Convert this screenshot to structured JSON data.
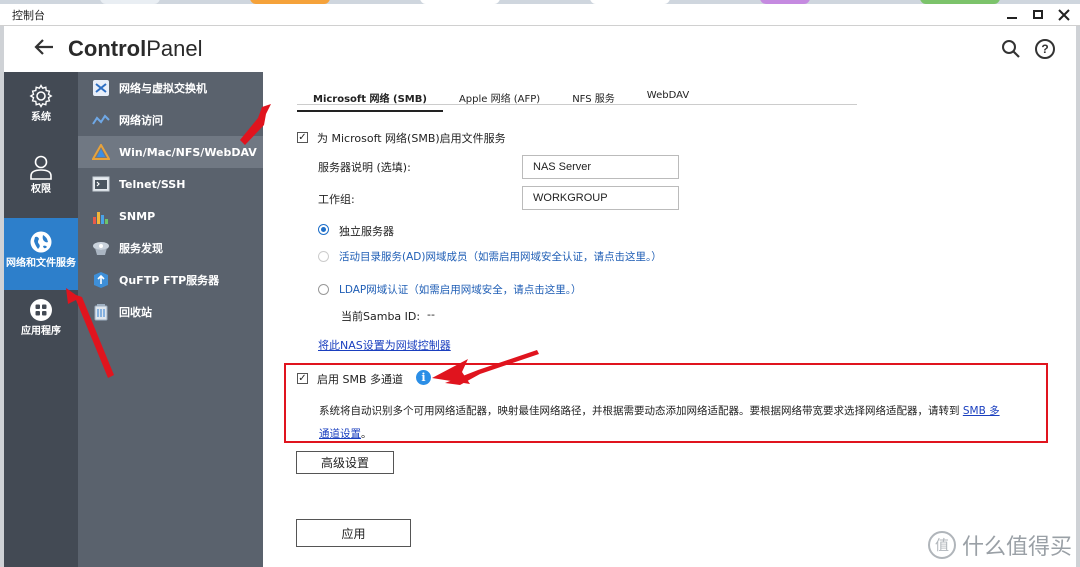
{
  "window": {
    "title": "控制台"
  },
  "header": {
    "app_title_bold": "Control",
    "app_title_rest": "Panel"
  },
  "nav1": [
    {
      "label": "系统",
      "icon": "gear-icon"
    },
    {
      "label": "权限",
      "icon": "user-icon"
    },
    {
      "label": "网络和文件服务",
      "icon": "globe-icon",
      "active": true
    },
    {
      "label": "应用程序",
      "icon": "apps-grid-icon"
    }
  ],
  "nav2": [
    {
      "label": "网络与虚拟交换机",
      "icon": "network-switch-icon"
    },
    {
      "label": "网络访问",
      "icon": "network-access-icon"
    },
    {
      "label": "Win/Mac/NFS/WebDAV",
      "icon": "file-service-icon",
      "active": true
    },
    {
      "label": "Telnet/SSH",
      "icon": "terminal-icon"
    },
    {
      "label": "SNMP",
      "icon": "bar-chart-icon"
    },
    {
      "label": "服务发现",
      "icon": "service-discovery-icon"
    },
    {
      "label": "QuFTP FTP服务器",
      "icon": "ftp-icon"
    },
    {
      "label": "回收站",
      "icon": "recycle-bin-icon"
    }
  ],
  "tabs": [
    "Microsoft 网络 (SMB)",
    "Apple 网络 (AFP)",
    "NFS 服务",
    "WebDAV"
  ],
  "smb": {
    "enable_label": "为 Microsoft 网络(SMB)启用文件服务",
    "enable_checked": true,
    "server_desc_label": "服务器说明 (选填):",
    "server_desc_value": "NAS Server",
    "workgroup_label": "工作组:",
    "workgroup_value": "WORKGROUP",
    "radio_standalone": "独立服务器",
    "radio_ad": "活动目录服务(AD)网域成员（如需启用网域安全认证，请点击这里。）",
    "radio_ldap": "LDAP网域认证（如需启用网域安全，请点击这里。）",
    "samba_id_label": "当前Samba ID:",
    "samba_id_value": "--",
    "domain_controller_link": "将此NAS设置为网域控制器",
    "multichannel_label": "启用 SMB 多通道",
    "multichannel_checked": true,
    "multichannel_desc": "系统将自动识别多个可用网络适配器，映射最佳网络路径，并根据需要动态添加网络适配器。要根据网络带宽要求选择网络适配器，请转到",
    "multichannel_link_a": "SMB 多",
    "multichannel_link_b": "通道设置",
    "multichannel_desc_end": "。",
    "advanced_button": "高级设置",
    "apply_button": "应用"
  },
  "watermark": {
    "text": "什么值得买",
    "logo": "值"
  },
  "colors": {
    "nav1_bg": "#434a54",
    "nav1_active": "#2d7fcb",
    "nav2_bg": "#5a626d",
    "annotation_red": "#e0141e"
  }
}
